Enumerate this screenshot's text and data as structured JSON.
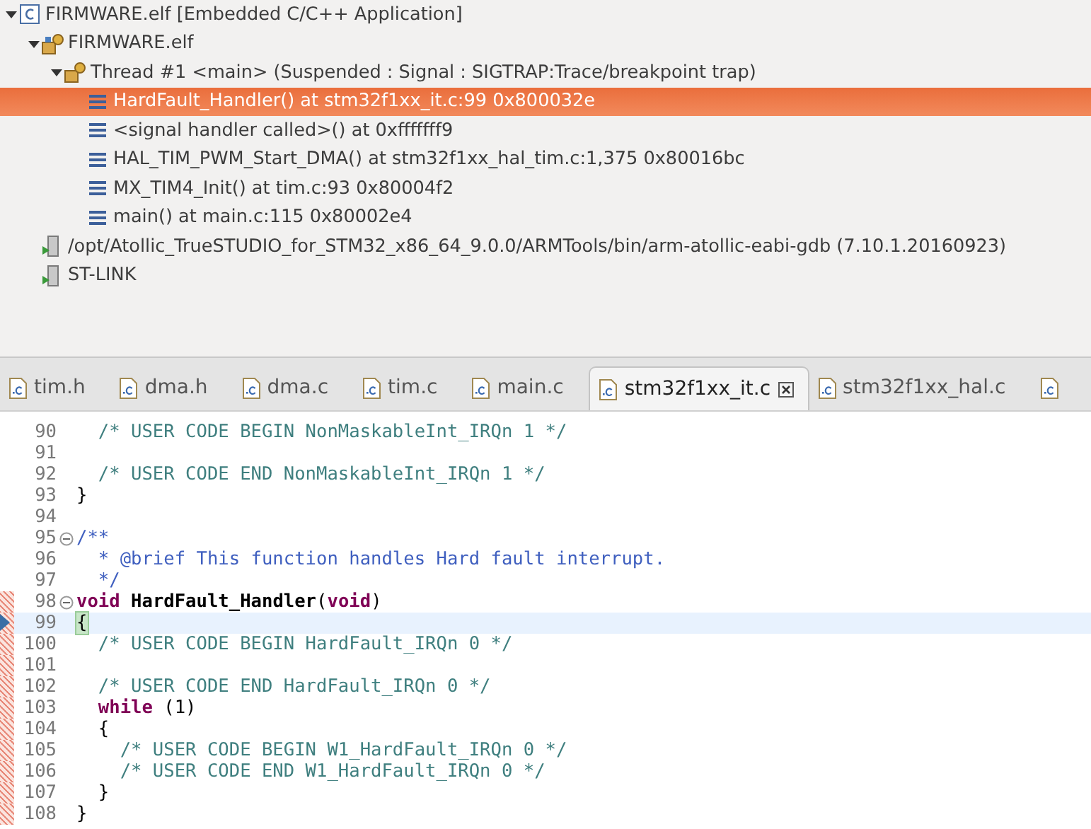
{
  "debug_tree": [
    {
      "label": "FIRMWARE.elf [Embedded C/C++ Application]",
      "kind": "launch",
      "expanded": true,
      "selected": false,
      "children": [
        {
          "label": "FIRMWARE.elf",
          "kind": "target",
          "expanded": true,
          "selected": false,
          "children": [
            {
              "label": "Thread #1 <main> (Suspended : Signal : SIGTRAP:Trace/breakpoint trap)",
              "kind": "thread",
              "expanded": true,
              "selected": false,
              "children": [
                {
                  "label": "HardFault_Handler() at stm32f1xx_it.c:99 0x800032e",
                  "kind": "frame",
                  "selected": true
                },
                {
                  "label": "<signal handler called>() at 0xfffffff9",
                  "kind": "frame",
                  "selected": false
                },
                {
                  "label": "HAL_TIM_PWM_Start_DMA() at stm32f1xx_hal_tim.c:1,375 0x80016bc",
                  "kind": "frame",
                  "selected": false
                },
                {
                  "label": "MX_TIM4_Init() at tim.c:93 0x80004f2",
                  "kind": "frame",
                  "selected": false
                },
                {
                  "label": "main() at main.c:115 0x80002e4",
                  "kind": "frame",
                  "selected": false
                }
              ]
            }
          ]
        },
        {
          "label": "/opt/Atollic_TrueSTUDIO_for_STM32_x86_64_9.0.0/ARMTools/bin/arm-atollic-eabi-gdb (7.10.1.20160923)",
          "kind": "process",
          "selected": false
        },
        {
          "label": "ST-LINK",
          "kind": "process",
          "selected": false
        }
      ]
    }
  ],
  "editor_tabs": [
    {
      "label": "tim.h",
      "selected": false
    },
    {
      "label": "dma.h",
      "selected": false
    },
    {
      "label": "dma.c",
      "selected": false
    },
    {
      "label": "tim.c",
      "selected": false
    },
    {
      "label": "main.c",
      "selected": false
    },
    {
      "label": "stm32f1xx_it.c",
      "selected": true
    },
    {
      "label": "stm32f1xx_hal.c",
      "selected": false
    },
    {
      "selected": false
    }
  ],
  "code_lines": [
    {
      "number": "90",
      "current": false,
      "fold": false,
      "range": false,
      "tokens": [
        {
          "kind": "comment",
          "text": "  /* USER CODE BEGIN NonMaskableInt_IRQn 1 */"
        }
      ]
    },
    {
      "number": "91",
      "current": false,
      "fold": false,
      "range": false
    },
    {
      "number": "92",
      "current": false,
      "fold": false,
      "range": false,
      "tokens": [
        {
          "kind": "comment",
          "text": "  /* USER CODE END NonMaskableInt_IRQn 1 */"
        }
      ]
    },
    {
      "number": "93",
      "current": false,
      "fold": false,
      "range": false,
      "tokens": [
        {
          "kind": "plain",
          "text": "}"
        }
      ]
    },
    {
      "number": "94",
      "current": false,
      "fold": false,
      "range": false
    },
    {
      "number": "95",
      "current": false,
      "fold": true,
      "range": false,
      "tokens": [
        {
          "kind": "doc",
          "text": "/**"
        }
      ]
    },
    {
      "number": "96",
      "current": false,
      "fold": false,
      "range": false,
      "tokens": [
        {
          "kind": "doc",
          "text": "  * @brief This function handles Hard fault interrupt."
        }
      ]
    },
    {
      "number": "97",
      "current": false,
      "fold": false,
      "range": false,
      "tokens": [
        {
          "kind": "doc",
          "text": "  */"
        }
      ]
    },
    {
      "number": "98",
      "current": false,
      "fold": true,
      "range": true,
      "tokens": [
        {
          "kind": "keyword",
          "text": "void"
        },
        {
          "kind": "function",
          "text": " HardFault_Handler"
        },
        {
          "kind": "plain",
          "text": "("
        },
        {
          "kind": "keyword",
          "text": "void"
        },
        {
          "kind": "plain",
          "text": ")"
        }
      ]
    },
    {
      "number": "99",
      "current": true,
      "fold": false,
      "range": true,
      "tokens": [
        {
          "kind": "bracket",
          "text": "{"
        }
      ]
    },
    {
      "number": "100",
      "current": false,
      "fold": false,
      "range": true,
      "tokens": [
        {
          "kind": "comment",
          "text": "  /* USER CODE BEGIN HardFault_IRQn 0 */"
        }
      ]
    },
    {
      "number": "101",
      "current": false,
      "fold": false,
      "range": true
    },
    {
      "number": "102",
      "current": false,
      "fold": false,
      "range": true,
      "tokens": [
        {
          "kind": "comment",
          "text": "  /* USER CODE END HardFault_IRQn 0 */"
        }
      ]
    },
    {
      "number": "103",
      "current": false,
      "fold": false,
      "range": true,
      "tokens": [
        {
          "kind": "keyword",
          "text": "  while"
        },
        {
          "kind": "plain",
          "text": " (1)"
        }
      ]
    },
    {
      "number": "104",
      "current": false,
      "fold": false,
      "range": true,
      "tokens": [
        {
          "kind": "plain",
          "text": "  {"
        }
      ]
    },
    {
      "number": "105",
      "current": false,
      "fold": false,
      "range": true,
      "tokens": [
        {
          "kind": "comment",
          "text": "    /* USER CODE BEGIN W1_HardFault_IRQn 0 */"
        }
      ]
    },
    {
      "number": "106",
      "current": false,
      "fold": false,
      "range": true,
      "tokens": [
        {
          "kind": "comment",
          "text": "    /* USER CODE END W1_HardFault_IRQn 0 */"
        }
      ]
    },
    {
      "number": "107",
      "current": false,
      "fold": false,
      "range": true,
      "tokens": [
        {
          "kind": "plain",
          "text": "  }"
        }
      ]
    },
    {
      "number": "108",
      "current": false,
      "fold": false,
      "range": true,
      "tokens": [
        {
          "kind": "plain",
          "text": "}"
        }
      ]
    }
  ]
}
